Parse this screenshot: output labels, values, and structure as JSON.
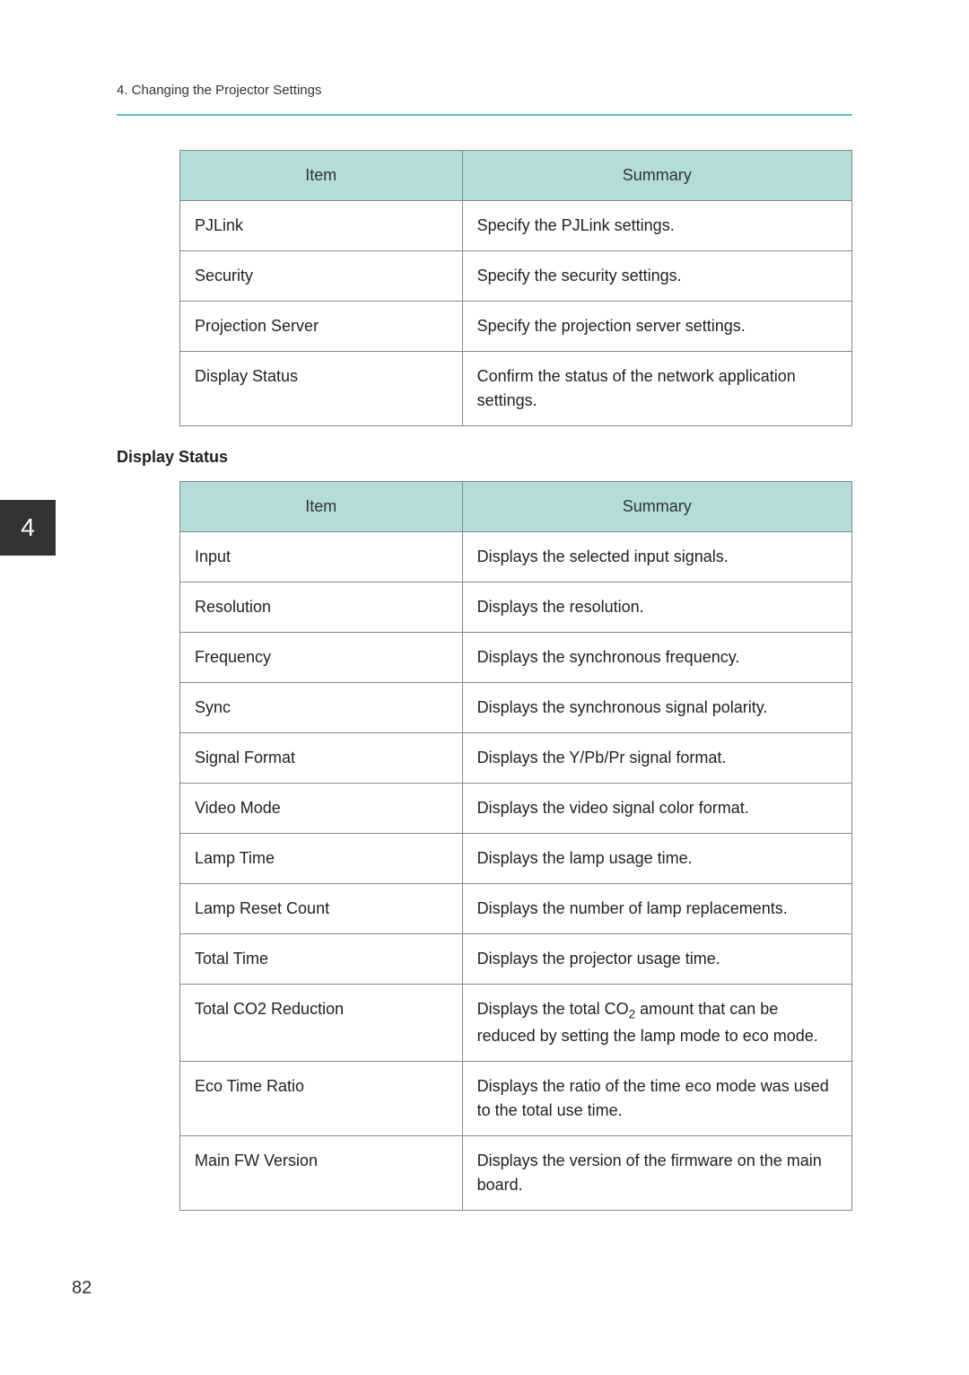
{
  "header": {
    "breadcrumb": "4. Changing the Projector Settings"
  },
  "sideTab": "4",
  "pageNumber": "82",
  "table1": {
    "headers": {
      "item": "Item",
      "summary": "Summary"
    },
    "rows": [
      {
        "item": "PJLink",
        "summary": "Specify the PJLink settings."
      },
      {
        "item": "Security",
        "summary": "Specify the security settings."
      },
      {
        "item": "Projection Server",
        "summary": "Specify the projection server settings."
      },
      {
        "item": "Display Status",
        "summary": "Confirm the status of the network application settings."
      }
    ]
  },
  "sectionHeading": "Display Status",
  "table2": {
    "headers": {
      "item": "Item",
      "summary": "Summary"
    },
    "rows": [
      {
        "item": "Input",
        "summary": "Displays the selected input signals."
      },
      {
        "item": "Resolution",
        "summary": "Displays the resolution."
      },
      {
        "item": "Frequency",
        "summary": "Displays the synchronous frequency."
      },
      {
        "item": "Sync",
        "summary": "Displays the synchronous signal polarity."
      },
      {
        "item": "Signal Format",
        "summary": "Displays the Y/Pb/Pr signal format."
      },
      {
        "item": "Video Mode",
        "summary": "Displays the video signal color format."
      },
      {
        "item": "Lamp Time",
        "summary": "Displays the lamp usage time."
      },
      {
        "item": "Lamp Reset Count",
        "summary": "Displays the number of lamp replacements."
      },
      {
        "item": "Total Time",
        "summary": "Displays the projector usage time."
      },
      {
        "item": "Total CO2 Reduction",
        "summary_pre": "Displays the total CO",
        "summary_sub": "2",
        "summary_post": " amount that can be reduced by setting the lamp mode to eco mode."
      },
      {
        "item": "Eco Time Ratio",
        "summary": "Displays the ratio of the time eco mode was used to the total use time."
      },
      {
        "item": "Main FW Version",
        "summary": "Displays the version of the firmware on the main board."
      }
    ]
  }
}
